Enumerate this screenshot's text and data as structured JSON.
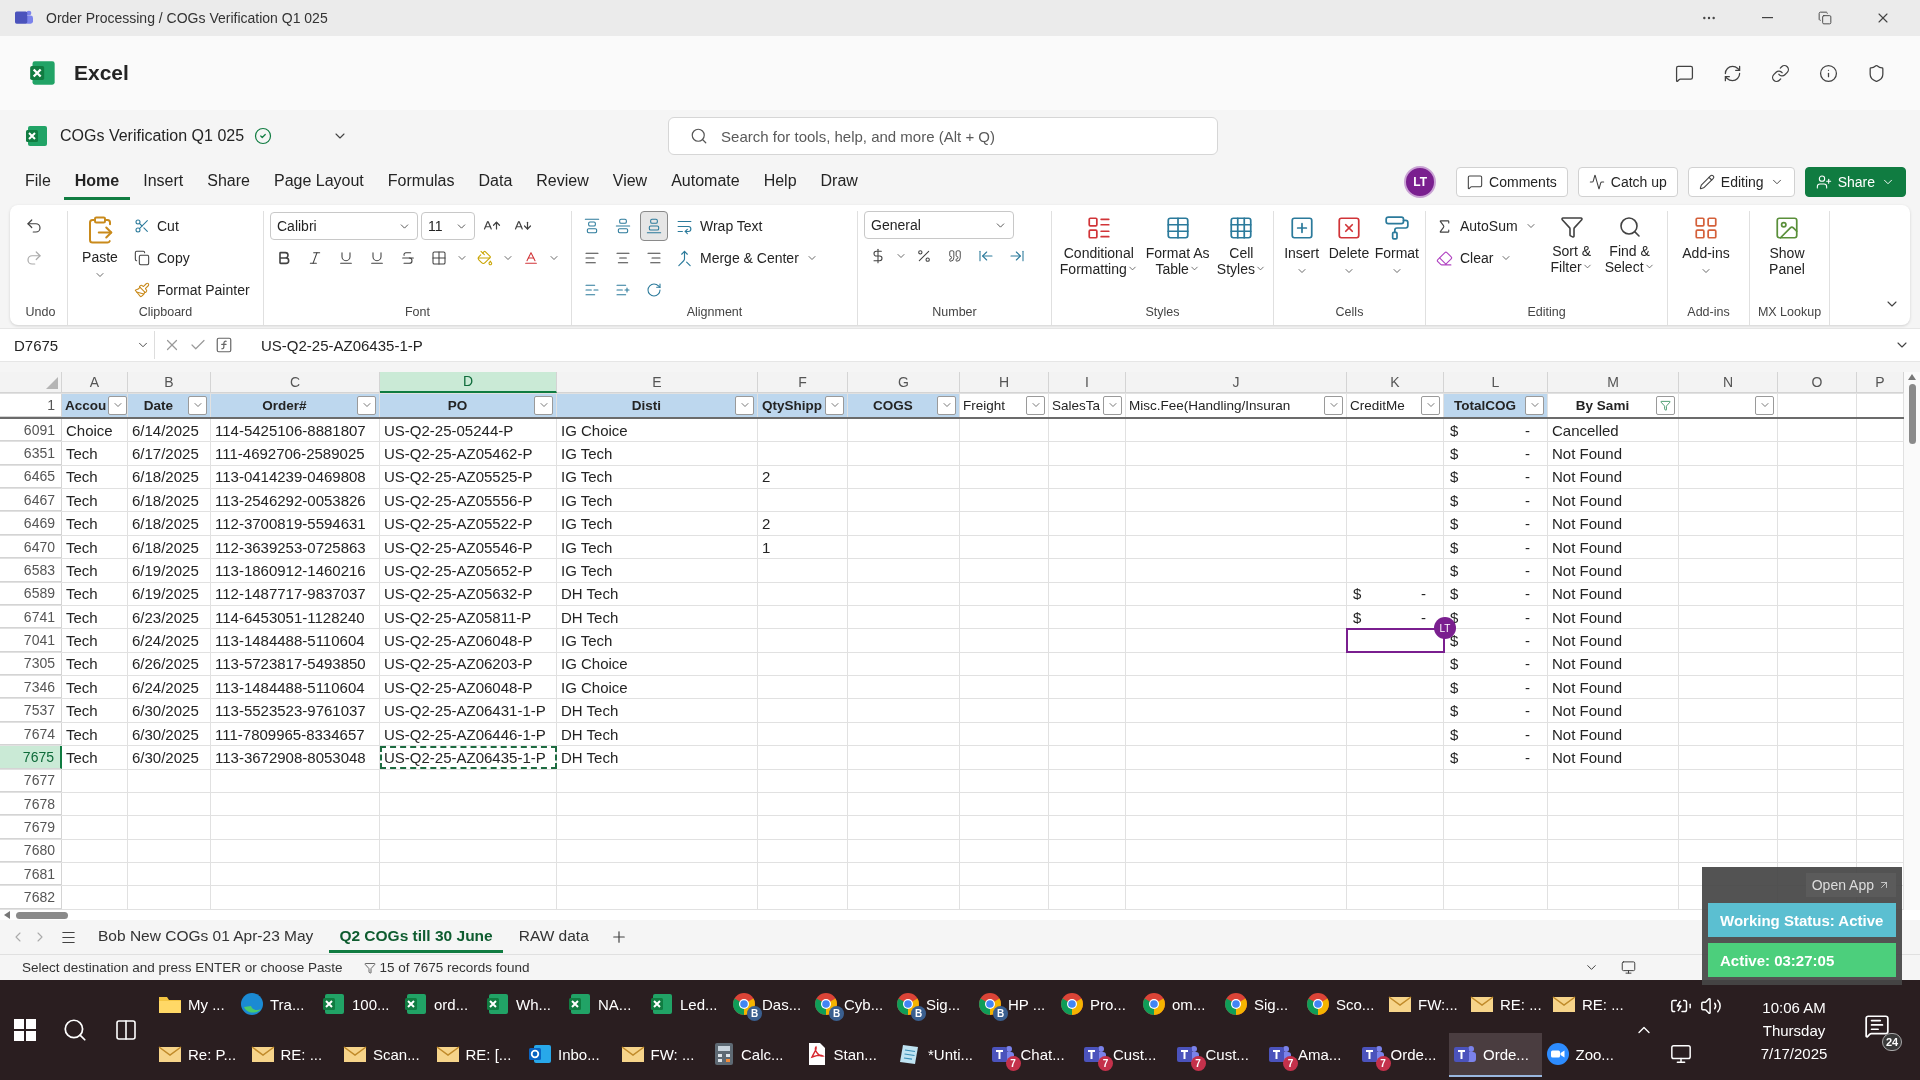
{
  "window": {
    "title": "Order Processing / COGs Verification Q1 025"
  },
  "app": {
    "name": "Excel"
  },
  "document": {
    "name": "COGs Verification Q1 025"
  },
  "search": {
    "placeholder": "Search for tools, help, and more (Alt + Q)"
  },
  "menu_tabs": [
    {
      "label": "File",
      "selected": false
    },
    {
      "label": "Home",
      "selected": true
    },
    {
      "label": "Insert",
      "selected": false
    },
    {
      "label": "Share",
      "selected": false
    },
    {
      "label": "Page Layout",
      "selected": false
    },
    {
      "label": "Formulas",
      "selected": false
    },
    {
      "label": "Data",
      "selected": false
    },
    {
      "label": "Review",
      "selected": false
    },
    {
      "label": "View",
      "selected": false
    },
    {
      "label": "Automate",
      "selected": false
    },
    {
      "label": "Help",
      "selected": false
    },
    {
      "label": "Draw",
      "selected": false
    }
  ],
  "account": {
    "initials": "LT"
  },
  "header_buttons": {
    "comments": "Comments",
    "catch_up": "Catch up",
    "editing": "Editing",
    "share": "Share"
  },
  "ribbon": {
    "undo": {
      "label": "Undo"
    },
    "clipboard": {
      "label": "Clipboard",
      "paste": "Paste",
      "cut": "Cut",
      "copy": "Copy",
      "format_painter": "Format Painter"
    },
    "font": {
      "label": "Font",
      "name": "Calibri",
      "size": "11"
    },
    "alignment": {
      "label": "Alignment",
      "vertical": [
        {
          "selected": false
        },
        {
          "selected": false
        },
        {
          "selected": true
        }
      ],
      "wrap_text": "Wrap Text",
      "merge": "Merge & Center"
    },
    "number": {
      "label": "Number",
      "format": "General"
    },
    "styles": {
      "label": "Styles",
      "buttons": [
        "Conditional Formatting",
        "Format As Table",
        "Cell Styles"
      ]
    },
    "cells": {
      "label": "Cells",
      "buttons": [
        "Insert",
        "Delete",
        "Format"
      ]
    },
    "editing": {
      "label": "Editing",
      "autosum": "AutoSum",
      "clear": "Clear",
      "buttons": [
        "Sort & Filter",
        "Find & Select"
      ]
    },
    "addins": {
      "label": "Add-ins",
      "button": "Add-ins"
    },
    "mx_lookup": {
      "label": "MX Lookup",
      "button": "Show Panel"
    }
  },
  "formula_bar": {
    "name_box": "D7675",
    "formula": "US-Q2-25-AZ06435-1-P"
  },
  "sheet": {
    "columns": [
      {
        "letter": "A",
        "selected": false
      },
      {
        "letter": "B",
        "selected": false
      },
      {
        "letter": "C",
        "selected": false
      },
      {
        "letter": "D",
        "selected": true
      },
      {
        "letter": "E",
        "selected": false
      },
      {
        "letter": "F",
        "selected": false
      },
      {
        "letter": "G",
        "selected": false
      },
      {
        "letter": "H",
        "selected": false
      },
      {
        "letter": "I",
        "selected": false
      },
      {
        "letter": "J",
        "selected": false
      },
      {
        "letter": "K",
        "selected": false
      },
      {
        "letter": "L",
        "selected": false
      },
      {
        "letter": "M",
        "selected": false
      },
      {
        "letter": "N",
        "selected": false
      },
      {
        "letter": "O",
        "selected": false
      },
      {
        "letter": "P",
        "selected": false
      }
    ],
    "header_row": {
      "number": "1",
      "cells": [
        {
          "text": "Accou",
          "highlighted": true,
          "bold": true,
          "filtered": false
        },
        {
          "text": "Date",
          "highlighted": true,
          "bold": true,
          "filtered": false
        },
        {
          "text": "Order#",
          "highlighted": true,
          "bold": true,
          "filtered": false
        },
        {
          "text": "PO",
          "highlighted": true,
          "bold": true,
          "filtered": false
        },
        {
          "text": "Disti",
          "highlighted": true,
          "bold": true,
          "filtered": false
        },
        {
          "text": "QtyShipp",
          "highlighted": true,
          "bold": true,
          "filtered": false
        },
        {
          "text": "COGS",
          "highlighted": true,
          "bold": true,
          "filtered": false
        },
        {
          "text": "Freight",
          "highlighted": false,
          "bold": false,
          "filtered": false
        },
        {
          "text": "SalesTa",
          "highlighted": false,
          "bold": false,
          "filtered": false
        },
        {
          "text": "Misc.Fee(Handling/Insuran",
          "highlighted": false,
          "bold": false,
          "filtered": false
        },
        {
          "text": "CreditMe",
          "highlighted": false,
          "bold": false,
          "filtered": false
        },
        {
          "text": "TotalCOG",
          "highlighted": true,
          "bold": true,
          "filtered": false
        },
        {
          "text": "By Sami",
          "highlighted": false,
          "bold": true,
          "filtered": true
        },
        {
          "filtered": false
        }
      ]
    },
    "rows": [
      {
        "number": "6091",
        "selected": false,
        "cells": {
          "A": "Choice",
          "B": "6/14/2025",
          "C": "114-5425106-8881807",
          "D": "US-Q2-25-05244-P",
          "E": "IG Choice",
          "L": {
            "symbol": "$",
            "amount": "-"
          },
          "M": "Cancelled"
        }
      },
      {
        "number": "6351",
        "selected": false,
        "cells": {
          "A": "Tech",
          "B": "6/17/2025",
          "C": "111-4692706-2589025",
          "D": "US-Q2-25-AZ05462-P",
          "E": "IG Tech",
          "L": {
            "symbol": "$",
            "amount": "-"
          },
          "M": "Not Found"
        }
      },
      {
        "number": "6465",
        "selected": false,
        "cells": {
          "A": "Tech",
          "B": "6/18/2025",
          "C": "113-0414239-0469808",
          "D": "US-Q2-25-AZ05525-P",
          "E": "IG Tech",
          "F": "2",
          "L": {
            "symbol": "$",
            "amount": "-"
          },
          "M": "Not Found"
        }
      },
      {
        "number": "6467",
        "selected": false,
        "cells": {
          "A": "Tech",
          "B": "6/18/2025",
          "C": "113-2546292-0053826",
          "D": "US-Q2-25-AZ05556-P",
          "E": "IG Tech",
          "L": {
            "symbol": "$",
            "amount": "-"
          },
          "M": "Not Found"
        }
      },
      {
        "number": "6469",
        "selected": false,
        "cells": {
          "A": "Tech",
          "B": "6/18/2025",
          "C": "112-3700819-5594631",
          "D": "US-Q2-25-AZ05522-P",
          "E": "IG Tech",
          "F": "2",
          "L": {
            "symbol": "$",
            "amount": "-"
          },
          "M": "Not Found"
        }
      },
      {
        "number": "6470",
        "selected": false,
        "cells": {
          "A": "Tech",
          "B": "6/18/2025",
          "C": "112-3639253-0725863",
          "D": "US-Q2-25-AZ05546-P",
          "E": "IG Tech",
          "F": "1",
          "L": {
            "symbol": "$",
            "amount": "-"
          },
          "M": "Not Found"
        }
      },
      {
        "number": "6583",
        "selected": false,
        "cells": {
          "A": "Tech",
          "B": "6/19/2025",
          "C": "113-1860912-1460216",
          "D": "US-Q2-25-AZ05652-P",
          "E": "IG Tech",
          "L": {
            "symbol": "$",
            "amount": "-"
          },
          "M": "Not Found"
        }
      },
      {
        "number": "6589",
        "selected": false,
        "cells": {
          "A": "Tech",
          "B": "6/19/2025",
          "C": "112-1487717-9837037",
          "D": "US-Q2-25-AZ05632-P",
          "E": "DH Tech",
          "K": {
            "symbol": "$",
            "amount": "-"
          },
          "L": {
            "symbol": "$",
            "amount": "-"
          },
          "M": "Not Found"
        }
      },
      {
        "number": "6741",
        "selected": false,
        "cells": {
          "A": "Tech",
          "B": "6/23/2025",
          "C": "114-6453051-1128240",
          "D": "US-Q2-25-AZ05811-P",
          "E": "DH Tech",
          "K": {
            "symbol": "$",
            "amount": "-"
          },
          "L": {
            "symbol": "$",
            "amount": "-"
          },
          "M": "Not Found"
        }
      },
      {
        "number": "7041",
        "selected": false,
        "cells": {
          "A": "Tech",
          "B": "6/24/2025",
          "C": "113-1484488-5110604",
          "D": "US-Q2-25-AZ06048-P",
          "E": "IG Tech",
          "K": {
            "collaborator": "LT"
          },
          "L": {
            "symbol": "$",
            "amount": "-"
          },
          "M": "Not Found"
        }
      },
      {
        "number": "7305",
        "selected": false,
        "cells": {
          "A": "Tech",
          "B": "6/26/2025",
          "C": "113-5723817-5493850",
          "D": "US-Q2-25-AZ06203-P",
          "E": "IG Choice",
          "L": {
            "symbol": "$",
            "amount": "-"
          },
          "M": "Not Found"
        }
      },
      {
        "number": "7346",
        "selected": false,
        "cells": {
          "A": "Tech",
          "B": "6/24/2025",
          "C": "113-1484488-5110604",
          "D": "US-Q2-25-AZ06048-P",
          "E": "IG Choice",
          "L": {
            "symbol": "$",
            "amount": "-"
          },
          "M": "Not Found"
        }
      },
      {
        "number": "7537",
        "selected": false,
        "cells": {
          "A": "Tech",
          "B": "6/30/2025",
          "C": "113-5523523-9761037",
          "D": "US-Q2-25-AZ06431-1-P",
          "E": "DH Tech",
          "L": {
            "symbol": "$",
            "amount": "-"
          },
          "M": "Not Found"
        }
      },
      {
        "number": "7674",
        "selected": false,
        "cells": {
          "A": "Tech",
          "B": "6/30/2025",
          "C": "111-7809965-8334657",
          "D": "US-Q2-25-AZ06446-1-P",
          "E": "DH Tech",
          "L": {
            "symbol": "$",
            "amount": "-"
          },
          "M": "Not Found"
        }
      },
      {
        "number": "7675",
        "selected": true,
        "cells": {
          "A": "Tech",
          "B": "6/30/2025",
          "C": "113-3672908-8053048",
          "D": {
            "text": "US-Q2-25-AZ06435-1-P",
            "copied": true
          },
          "E": "DH Tech",
          "L": {
            "symbol": "$",
            "amount": "-"
          },
          "M": "Not Found"
        }
      }
    ],
    "empty_rows": [
      "7677",
      "7678",
      "7679",
      "7680",
      "7681",
      "7682"
    ]
  },
  "sheet_tabs": [
    {
      "label": "Bob New COGs 01 Apr-23 May",
      "selected": false
    },
    {
      "label": "Q2 COGs till 30 June",
      "selected": true
    },
    {
      "label": "RAW data",
      "selected": false
    }
  ],
  "status_bar": {
    "message": "Select destination and press ENTER or choose Paste",
    "filter_count": "15 of 7675 records found"
  },
  "tracker_widget": {
    "open_button": "Open App",
    "working_status": "Working Status: Active",
    "active_time": "Active: 03:27:05"
  },
  "taskbar": {
    "top_row": [
      {
        "label": "My ...",
        "kind": "folder",
        "active": false
      },
      {
        "label": "Tra...",
        "kind": "edge",
        "active": false
      },
      {
        "label": "100...",
        "kind": "excel",
        "active": false
      },
      {
        "label": "ord...",
        "kind": "excel",
        "active": false
      },
      {
        "label": "Wh...",
        "kind": "excel",
        "active": false
      },
      {
        "label": "NA...",
        "kind": "excel",
        "active": false
      },
      {
        "label": "Led...",
        "kind": "excel",
        "active": false
      },
      {
        "label": "Das...",
        "kind": "chrome",
        "badge": "B",
        "active": false
      },
      {
        "label": "Cyb...",
        "kind": "chrome",
        "badge": "B",
        "active": false
      },
      {
        "label": "Sig...",
        "kind": "chrome",
        "badge": "B",
        "active": false
      },
      {
        "label": "HP ...",
        "kind": "chrome",
        "badge": "B",
        "active": false
      },
      {
        "label": "Pro...",
        "kind": "chrome",
        "active": false
      },
      {
        "label": "om...",
        "kind": "chrome",
        "active": false
      },
      {
        "label": "Sig...",
        "kind": "chrome",
        "active": false
      },
      {
        "label": "Sco...",
        "kind": "chrome",
        "active": false
      },
      {
        "label": "FW:...",
        "kind": "mail",
        "active": false
      },
      {
        "label": "RE: ...",
        "kind": "mail",
        "active": false
      },
      {
        "label": "RE: ...",
        "kind": "mail",
        "active": false
      }
    ],
    "bottom_row": [
      {
        "label": "Re: P...",
        "kind": "mail",
        "active": false
      },
      {
        "label": "RE: ...",
        "kind": "mail",
        "active": false
      },
      {
        "label": "Scan...",
        "kind": "mail",
        "active": false
      },
      {
        "label": "RE: [...",
        "kind": "mail",
        "active": false
      },
      {
        "label": "Inbo...",
        "kind": "outlook",
        "active": false
      },
      {
        "label": "FW: ...",
        "kind": "mail",
        "active": false
      },
      {
        "label": "Calc...",
        "kind": "calculator",
        "active": false
      },
      {
        "label": "Stan...",
        "kind": "pdf",
        "active": false
      },
      {
        "label": "*Unti...",
        "kind": "notepad",
        "active": false
      },
      {
        "label": "Chat...",
        "kind": "teams",
        "badge": "7",
        "active": false
      },
      {
        "label": "Cust...",
        "kind": "teams",
        "badge": "7",
        "active": false
      },
      {
        "label": "Cust...",
        "kind": "teams",
        "badge": "7",
        "active": false
      },
      {
        "label": "Ama...",
        "kind": "teams",
        "badge": "7",
        "active": false
      },
      {
        "label": "Orde...",
        "kind": "teams",
        "badge": "7",
        "active": false
      },
      {
        "label": "Orde...",
        "kind": "teams",
        "active": true
      },
      {
        "label": "Zoo...",
        "kind": "zoom",
        "active": false
      }
    ],
    "clock": {
      "time": "10:06 AM",
      "day": "Thursday",
      "date": "7/17/2025"
    },
    "notifications": "24"
  }
}
